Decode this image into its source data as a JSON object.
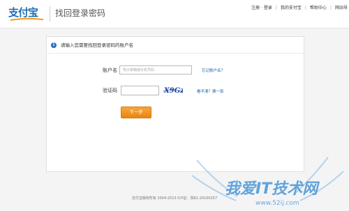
{
  "header": {
    "logo_text": "支付宝",
    "title": "找回登录密码",
    "nav": [
      "注册 · 登录",
      "我的支付宝",
      "帮助中心",
      "网站导"
    ]
  },
  "form": {
    "notice": "请输入您需要找回登录密码的账户名",
    "account_label": "账户名",
    "account_placeholder": "电子邮箱或手机号码",
    "forgot_link": "忘记账户名？",
    "captcha_label": "验证码",
    "captcha_code": "X9Gz",
    "refresh_link": "看不清？换一张",
    "next_button": "下一步"
  },
  "footer": {
    "copyright": "支付宝版权所有 2004-2013 ICP证：浙B2-20100257"
  },
  "watermark": {
    "text": "我爱IT技术网",
    "url": "www.52ij.com"
  },
  "colors": {
    "brand_blue": "#1a6fb7",
    "link_blue": "#1a5aa8",
    "button_orange": "#ef8f1f",
    "watermark_blue": "#3d8fd6"
  }
}
